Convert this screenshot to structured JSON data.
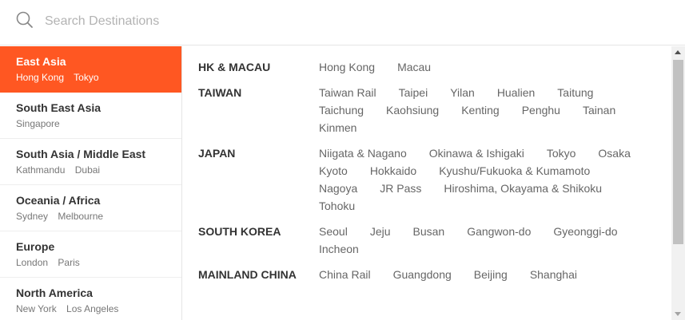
{
  "search": {
    "placeholder": "Search Destinations",
    "value": ""
  },
  "regions": [
    {
      "title": "East Asia",
      "subs": [
        "Hong Kong",
        "Tokyo"
      ],
      "active": true
    },
    {
      "title": "South East Asia",
      "subs": [
        "Singapore"
      ]
    },
    {
      "title": "South Asia / Middle East",
      "subs": [
        "Kathmandu",
        "Dubai"
      ]
    },
    {
      "title": "Oceania / Africa",
      "subs": [
        "Sydney",
        "Melbourne"
      ]
    },
    {
      "title": "Europe",
      "subs": [
        "London",
        "Paris"
      ]
    },
    {
      "title": "North America",
      "subs": [
        "New York",
        "Los Angeles"
      ]
    }
  ],
  "countries": [
    {
      "name": "HK & MACAU",
      "cities": [
        "Hong Kong",
        "Macau"
      ]
    },
    {
      "name": "TAIWAN",
      "cities": [
        "Taiwan Rail",
        "Taipei",
        "Yilan",
        "Hualien",
        "Taitung",
        "Taichung",
        "Kaohsiung",
        "Kenting",
        "Penghu",
        "Tainan",
        "Kinmen"
      ]
    },
    {
      "name": "JAPAN",
      "cities": [
        "Niigata & Nagano",
        "Okinawa & Ishigaki",
        "Tokyo",
        "Osaka",
        "Kyoto",
        "Hokkaido",
        "Kyushu/Fukuoka & Kumamoto",
        "Nagoya",
        "JR Pass",
        "Hiroshima, Okayama & Shikoku",
        "Tohoku"
      ]
    },
    {
      "name": "SOUTH KOREA",
      "cities": [
        "Seoul",
        "Jeju",
        "Busan",
        "Gangwon-do",
        "Gyeonggi-do",
        "Incheon"
      ]
    },
    {
      "name": "MAINLAND CHINA",
      "cities": [
        "China Rail",
        "Guangdong",
        "Beijing",
        "Shanghai"
      ]
    }
  ],
  "colors": {
    "accent": "#ff5722"
  }
}
